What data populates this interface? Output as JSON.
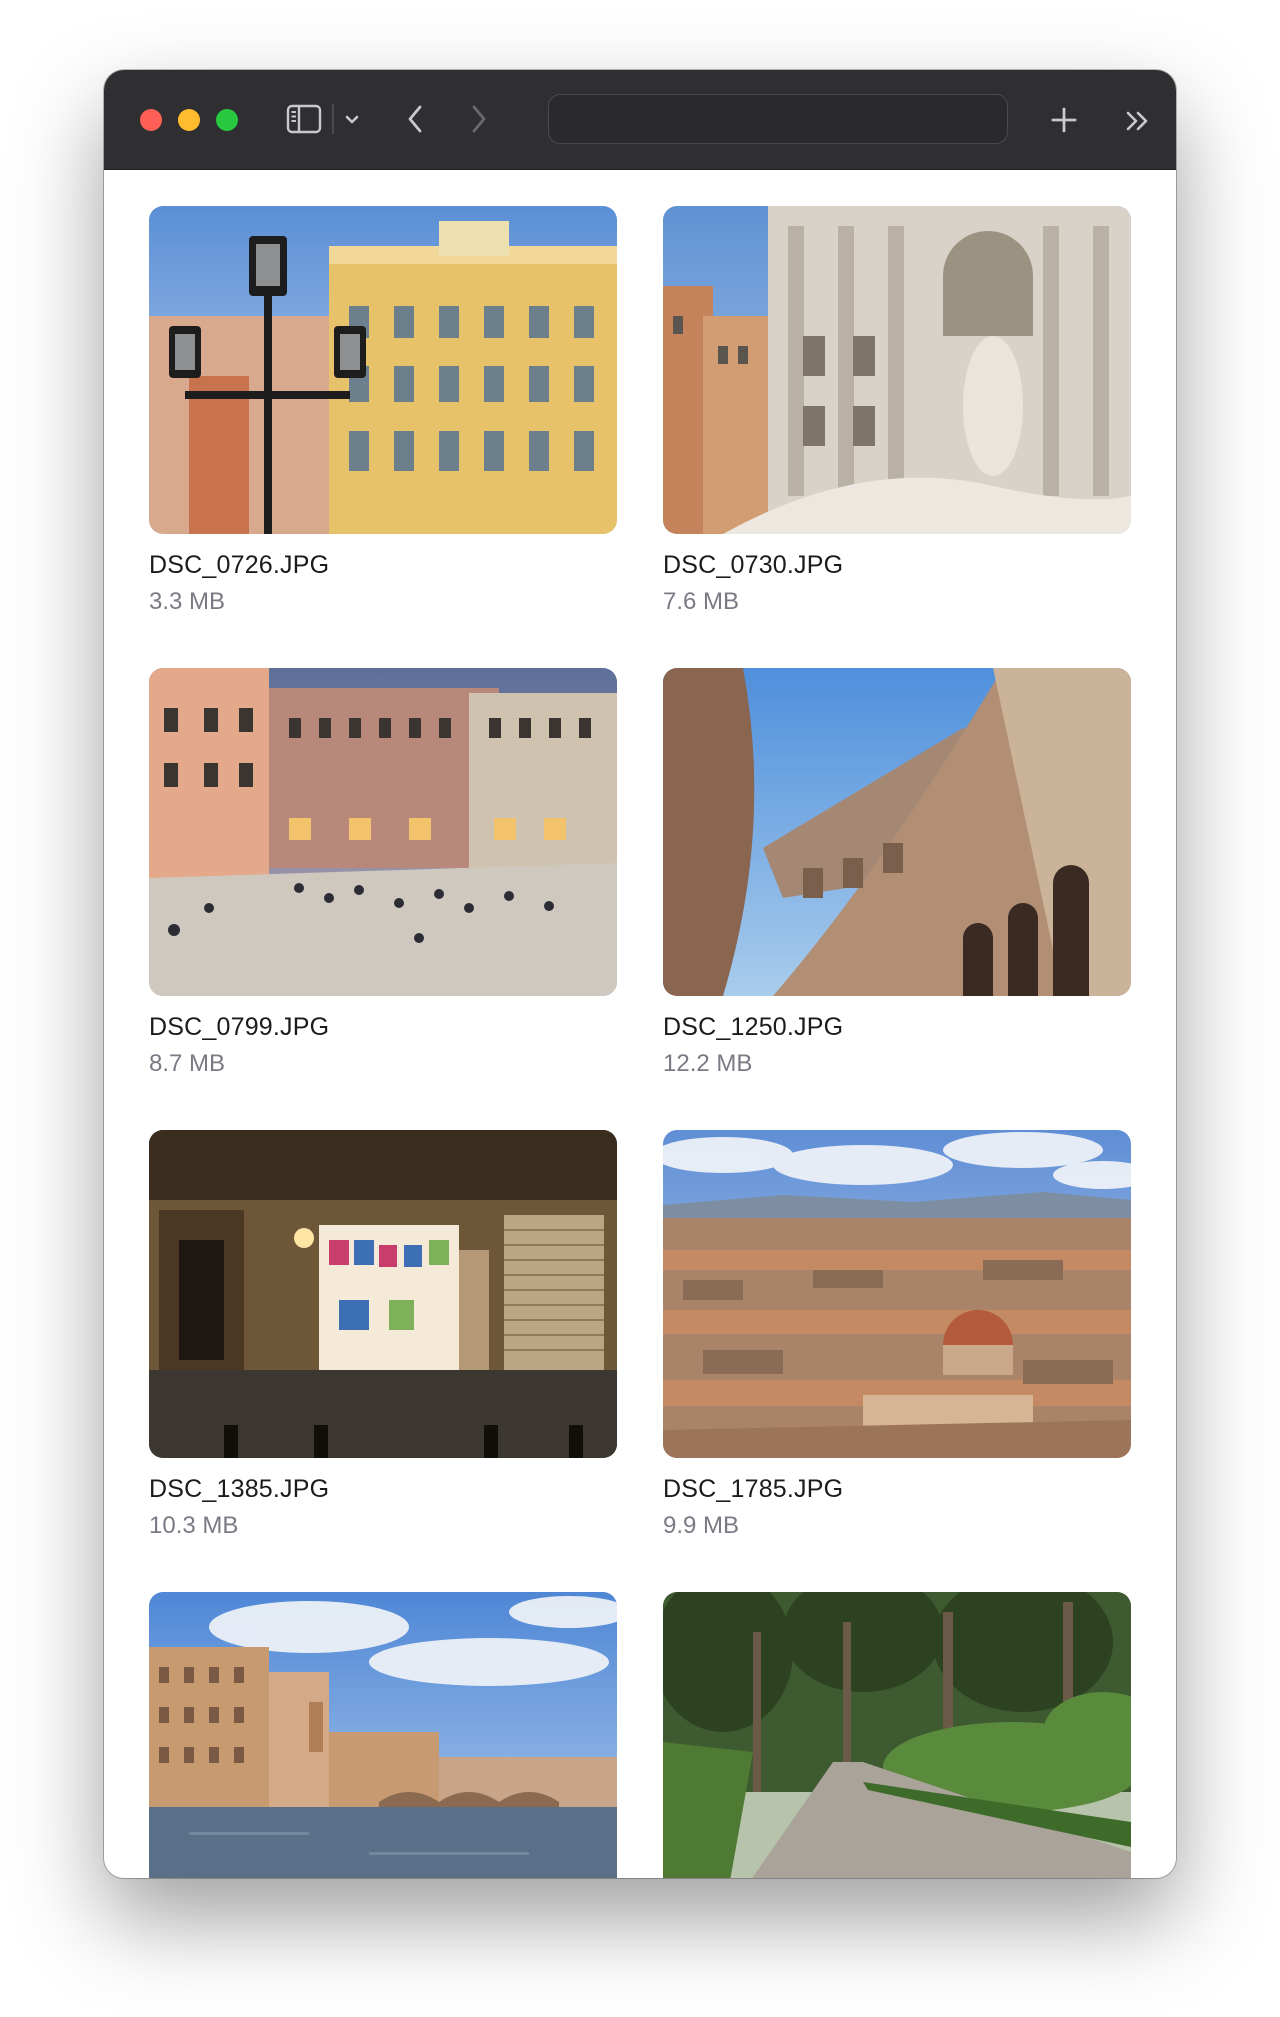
{
  "window": {
    "controls": [
      "close",
      "minimize",
      "zoom"
    ],
    "address_bar": {
      "value": ""
    },
    "icons": {
      "sidebar": "sidebar-icon",
      "sidebar_menu": "chevron-down-icon",
      "back": "chevron-left-icon",
      "forward": "chevron-right-icon",
      "new_tab": "plus-icon",
      "overflow": "double-chevron-right-icon"
    }
  },
  "photos": [
    {
      "name": "DSC_0726.JPG",
      "size": "3.3 MB"
    },
    {
      "name": "DSC_0730.JPG",
      "size": "7.6 MB"
    },
    {
      "name": "DSC_0799.JPG",
      "size": "8.7 MB"
    },
    {
      "name": "DSC_1250.JPG",
      "size": "12.2 MB"
    },
    {
      "name": "DSC_1385.JPG",
      "size": "10.3 MB"
    },
    {
      "name": "DSC_1785.JPG",
      "size": "9.9 MB"
    },
    {
      "name": "",
      "size": ""
    },
    {
      "name": "",
      "size": ""
    }
  ],
  "colors": {
    "toolbar": "#2f2f31",
    "close": "#fe5f57",
    "minimize": "#febc2e",
    "zoom": "#28c840",
    "filename": "#1b1b1d",
    "filesize": "#7a7a85"
  }
}
